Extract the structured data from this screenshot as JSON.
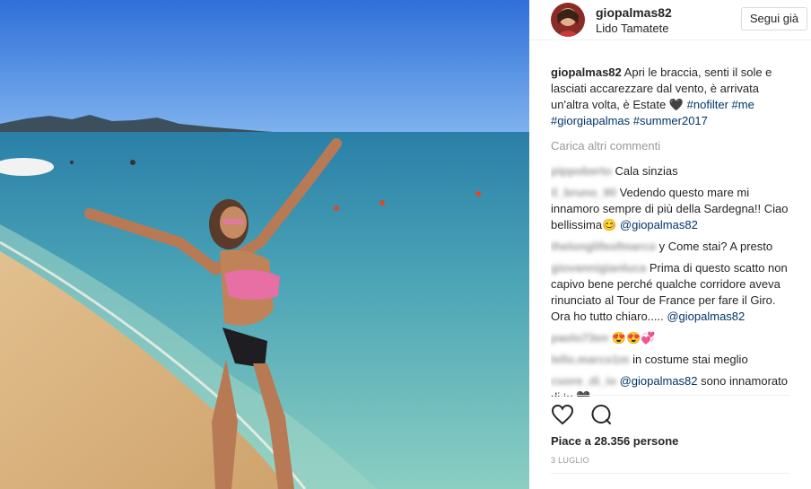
{
  "header": {
    "username": "giopalmas82",
    "location": "Lido Tamatete",
    "follow_label": "Segui già"
  },
  "caption": {
    "username": "giopalmas82",
    "text": "Apri le braccia, senti il sole e lasciati accarezzare dal vento, è arrivata un'altra volta, è Estate 🖤",
    "hashtags": [
      "#nofilter",
      "#me",
      "#giorgiapalmas",
      "#summer2017"
    ]
  },
  "load_more": "Carica altri commenti",
  "comments": [
    {
      "user": "pippoberto",
      "text": "Cala sinzias"
    },
    {
      "user": "il_bruno_90",
      "text": "Vedendo questo mare mi innamoro sempre di più della Sardegna!! Ciao bellissima😊",
      "mention": "@giopalmas82"
    },
    {
      "user": "thelonglifeofmarco",
      "text": "y Come stai? A presto"
    },
    {
      "user": "giovannigianluca",
      "text": "Prima di questo scatto non capivo bene perché qualche corridore aveva rinunciato al Tour de France per fare il Giro. Ora ho tutto chiaro.....",
      "mention": "@giopalmas82"
    },
    {
      "user": "paolo73en",
      "text": "😍😍💞"
    },
    {
      "user": "lello.marco1m",
      "text": "in costume stai meglio"
    },
    {
      "user": "cuore_di_io",
      "text": "sono innamorato di te 🖤",
      "mention": "@giopalmas82"
    }
  ],
  "icons": {
    "like": "heart-icon",
    "comment": "comment-icon"
  },
  "likes": "Piace a 28.356 persone",
  "date": "3 LUGLIO",
  "colors": {
    "hashtag": "#003569",
    "muted": "#999999",
    "border": "#efefef"
  }
}
